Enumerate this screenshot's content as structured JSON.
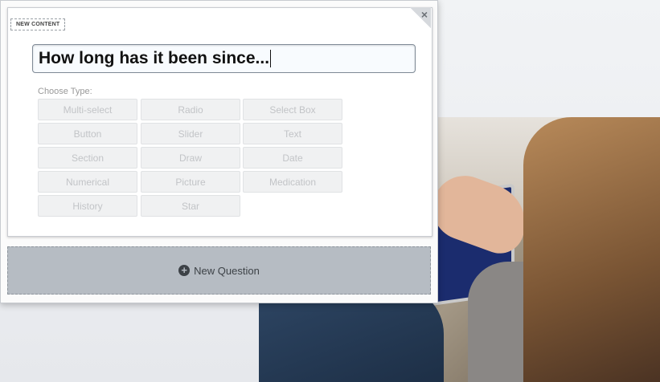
{
  "card": {
    "tag_label": "NEW CONTENT",
    "close_glyph": "×",
    "question_text": "How long has it been since...",
    "choose_type_label": "Choose Type:",
    "types": [
      "Multi-select",
      "Radio",
      "Select Box",
      "Button",
      "Slider",
      "Text",
      "Section",
      "Draw",
      "Date",
      "Numerical",
      "Picture",
      "Medication",
      "History",
      "Star"
    ],
    "new_question_label": "New Question",
    "new_question_icon": "plus-circle-icon"
  },
  "colors": {
    "panel_bg": "#ffffff",
    "new_question_bg": "#b6bcc3",
    "type_button_bg": "#f0f1f2",
    "type_button_text": "#c2c4c7"
  }
}
